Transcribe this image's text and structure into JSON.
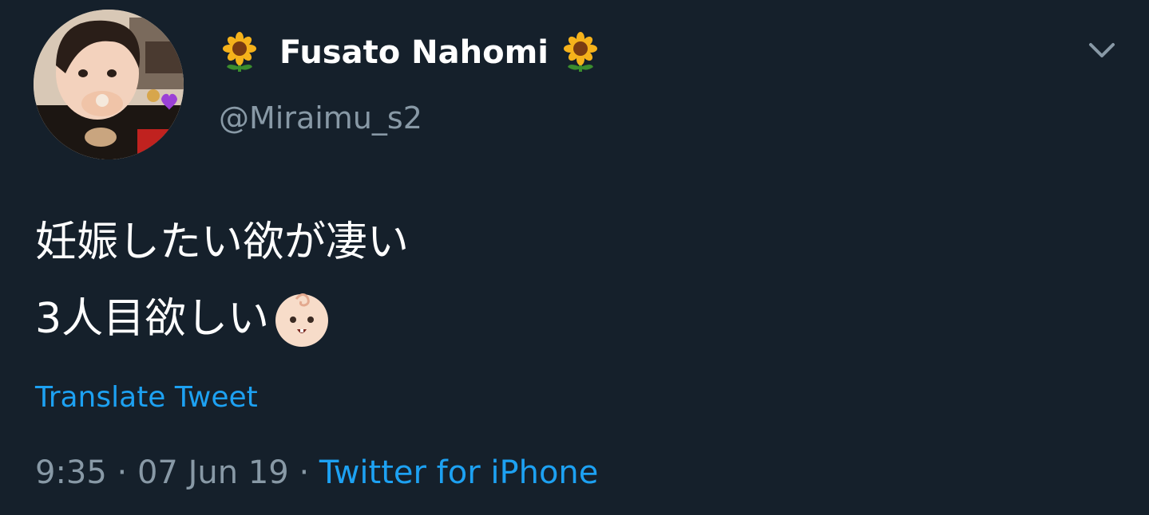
{
  "user": {
    "display_name": "Fusato Nahomi",
    "handle": "@Miraimu_s2",
    "name_emoji": "sunflower-icon"
  },
  "tweet": {
    "lines": [
      "妊娠したい欲が凄い",
      "3人目欲しい"
    ],
    "line_end_emoji": "baby-face-icon",
    "translate_label": "Translate Tweet",
    "time": "9:35",
    "separator": "·",
    "date": "07 Jun 19",
    "source": "Twitter for iPhone"
  },
  "actions": {
    "menu_icon": "chevron-down-icon"
  },
  "colors": {
    "background": "#15202b",
    "text": "#ffffff",
    "muted": "#8899a6",
    "accent": "#1da1f2"
  }
}
